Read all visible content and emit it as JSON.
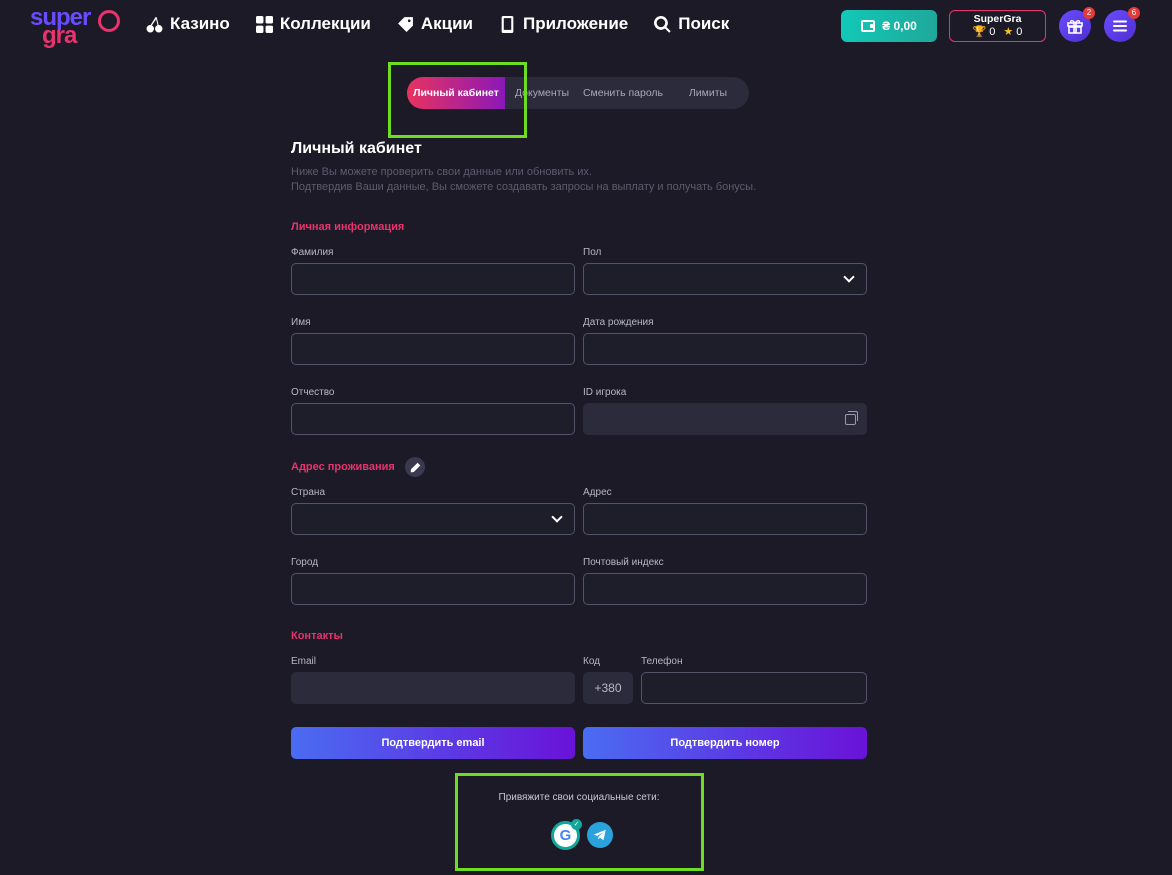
{
  "header": {
    "logo_top": "super",
    "logo_bottom": "gra",
    "nav": [
      {
        "label": "Казино",
        "icon": "cherry-icon"
      },
      {
        "label": "Коллекции",
        "icon": "grid-icon"
      },
      {
        "label": "Акции",
        "icon": "tag-icon"
      },
      {
        "label": "Приложение",
        "icon": "phone-icon"
      },
      {
        "label": "Поиск",
        "icon": "search-icon"
      }
    ],
    "balance": "₴ 0,00",
    "user": {
      "name": "SuperGra",
      "trophies": "0",
      "stars": "0"
    },
    "gift_badge": "2",
    "menu_badge": "6"
  },
  "tabs": [
    {
      "label": "Личный кабинет",
      "active": true
    },
    {
      "label": "Документы",
      "active": false
    },
    {
      "label": "Сменить пароль",
      "active": false
    },
    {
      "label": "Лимиты",
      "active": false
    }
  ],
  "page": {
    "title": "Личный кабинет",
    "desc_line1": "Ниже Вы можете проверить свои данные или обновить их.",
    "desc_line2": "Подтвердив Ваши данные, Вы сможете создавать запросы на выплату и получать бонусы."
  },
  "personal": {
    "section": "Личная информация",
    "surname": "Фамилия",
    "gender": "Пол",
    "name": "Имя",
    "birthdate": "Дата рождения",
    "patronymic": "Отчество",
    "player_id": "ID игрока"
  },
  "address": {
    "section": "Адрес проживания",
    "country": "Страна",
    "address": "Адрес",
    "city": "Город",
    "postal": "Почтовый индекс"
  },
  "contacts": {
    "section": "Контакты",
    "email": "Email",
    "code": "Код",
    "phone": "Телефон",
    "code_value": "+380"
  },
  "actions": {
    "confirm_email": "Подтвердить email",
    "confirm_phone": "Подтвердить номер"
  },
  "social": {
    "title": "Привяжите свои социальные сети:",
    "google_letter": "G",
    "google_check": "✓"
  },
  "colors": {
    "background": "#1b1a26",
    "accent_pink": "#e8336e",
    "accent_purple": "#6a12d8",
    "wallet_teal": "#12c8b8",
    "highlight_green": "#6fdc24"
  }
}
